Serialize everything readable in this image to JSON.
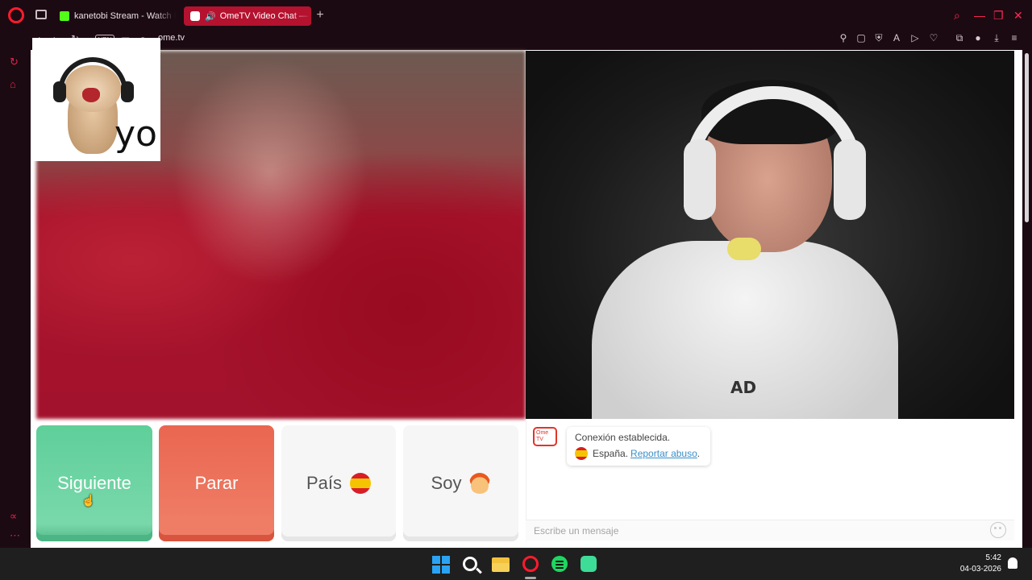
{
  "browser": {
    "tabs": [
      {
        "label": "kanetobi Stream - Watch L",
        "favicon": "kick-icon",
        "active": false
      },
      {
        "label": "OmeTV Video Chat — ",
        "favicon": "ometv-icon",
        "active": true,
        "audio": "speaker-icon"
      }
    ],
    "new_tab": "+",
    "window_controls": {
      "search": "search-icon",
      "minimize": "—",
      "maximize": "❐",
      "close": "✕"
    },
    "address": {
      "vpn_badge": "VPN",
      "url": "ome.tv"
    },
    "accent_color": "#ff1b2d"
  },
  "sticker": {
    "caption": "yo"
  },
  "controls": {
    "next_label": "Siguiente",
    "stop_label": "Parar",
    "country_label": "País",
    "gender_label": "Soy"
  },
  "chat": {
    "logo_text": "Ome TV",
    "status_line": "Conexión establecida.",
    "country_name": "España.",
    "report_link": "Reportar abuso",
    "report_suffix": ".",
    "input_placeholder": "Escribe un mensaje"
  },
  "right_video": {
    "shirt_text": "AD"
  },
  "taskbar": {
    "time": "5:42",
    "date": "04-03-2026"
  }
}
